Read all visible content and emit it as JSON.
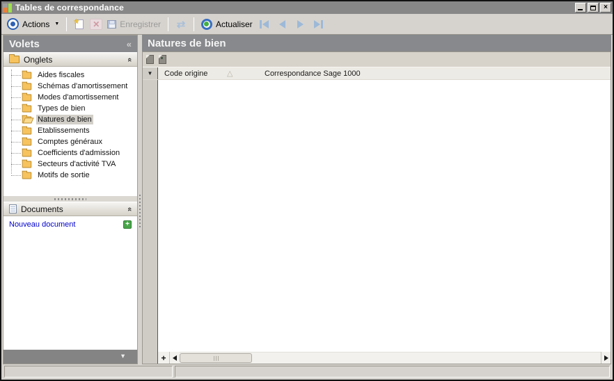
{
  "window": {
    "title": "Tables de correspondance"
  },
  "toolbar": {
    "actions_label": "Actions",
    "enregistrer_label": "Enregistrer",
    "actualiser_label": "Actualiser"
  },
  "sidebar": {
    "title": "Volets",
    "onglets": {
      "label": "Onglets",
      "items": [
        "Aides fiscales",
        "Schémas d'amortissement",
        "Modes d'amortissement",
        "Types de bien",
        "Natures de bien",
        "Etablissements",
        "Comptes généraux",
        "Coefficients d'admission",
        "Secteurs d'activité TVA",
        "Motifs de sortie"
      ],
      "selected_item": "Natures de bien"
    },
    "documents": {
      "label": "Documents",
      "new_document_label": "Nouveau document"
    }
  },
  "main": {
    "title": "Natures de bien",
    "grid": {
      "columns": [
        "Code origine",
        "Correspondance Sage 1000"
      ],
      "rows": []
    }
  },
  "icons": {
    "collapse_left": "«",
    "section_chevron_up": "«",
    "sort_ascending": "△",
    "row_marker": "▼",
    "panel_collapse_down": "▼",
    "close": "×",
    "plus": "+",
    "add_row": "+",
    "sync": "⇄",
    "new_star": "★",
    "delete_x": "✕",
    "caret_down": "▼"
  },
  "colors": {
    "titlebar_gray": "#878787",
    "panel_header_gray": "#87898c",
    "window_bg": "#d6d3ce",
    "selection_bg": "#d2cfc9",
    "link_blue": "#0000cc",
    "accent_blue": "#2f62b5",
    "accent_green": "#45b045",
    "folder_yellow": "#f6c35f",
    "nav_arrow_blue": "#9db9d8"
  }
}
